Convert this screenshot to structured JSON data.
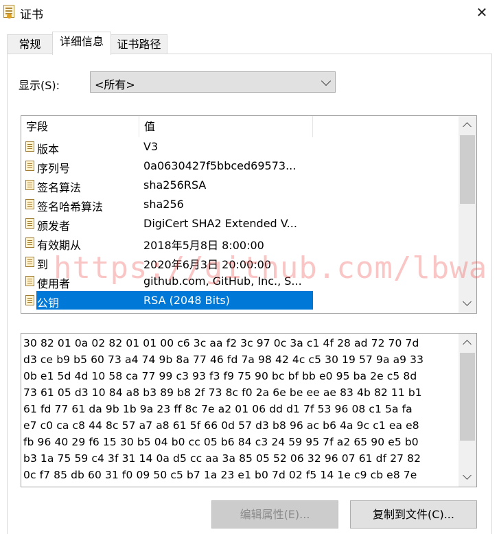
{
  "window": {
    "title": "证书",
    "close_glyph": "✕"
  },
  "tabs": [
    {
      "label": "常规",
      "active": false
    },
    {
      "label": "详细信息",
      "active": true
    },
    {
      "label": "证书路径",
      "active": false
    }
  ],
  "show": {
    "label": "显示(S):",
    "selected": "<所有>"
  },
  "fields_table": {
    "columns": [
      "字段",
      "值"
    ],
    "rows": [
      {
        "name": "版本",
        "value": "V3"
      },
      {
        "name": "序列号",
        "value": "0a0630427f5bbced69573..."
      },
      {
        "name": "签名算法",
        "value": "sha256RSA"
      },
      {
        "name": "签名哈希算法",
        "value": "sha256"
      },
      {
        "name": "颁发者",
        "value": "DigiCert SHA2 Extended V..."
      },
      {
        "name": "有效期从",
        "value": "2018年5月8日 8:00:00"
      },
      {
        "name": "到",
        "value": "2020年6月3日 20:00:00"
      },
      {
        "name": "使用者",
        "value": "github.com, GitHub, Inc., S..."
      },
      {
        "name": "公钥",
        "value": "RSA (2048 Bits)"
      }
    ],
    "selected_index": 8
  },
  "value_detail": [
    "30 82 01 0a 02 82 01 01 00 c6 3c aa f2 3c 97 0c 3a c1 4f 28 ad 72 70 7d",
    "d3 ce b9 b5 60 73 a4 74 9b 8a 77 46 fd 7a 98 42 4c c5 30 19 57 9a a9 33",
    "0b e1 5d 4d 10 58 ca 77 99 c3 93 f3 f9 75 90 bc bf bb e0 95 ba 2e c5 8d",
    "73 61 05 d3 10 84 a8 b3 89 b8 2f 73 8c f0 2a 6e be ee ae 83 4b 82 11 b1",
    "61 fd 77 61 da 9b 1b 9a 23 ff 8c 7e a2 01 06 dd d1 7f 53 96 08 c1 5a fa",
    "e7 c0 ca c8 44 8c 57 a7 a8 61 5f 66 0d 57 d3 b8 96 ac b6 4a 9c c1 ea e8",
    "fb 96 40 29 f6 15 30 b5 04 b0 cc 05 b6 84 c3 24 59 95 7f a2 65 90 e5 b0",
    "b3 1a 75 59 c4 3f 31 14 0a d5 cc aa 3a 85 05 52 06 32 96 07 61 df 27 82",
    "0c f7 85 db 60 31 f0 09 50 c5 b7 1a 23 e1 b0 7d 02 f5 14 1e c9 cb e8 7e"
  ],
  "buttons": {
    "edit_properties": "编辑属性(E)...",
    "copy_to_file": "复制到文件(C)..."
  },
  "watermark": "https://github.com/lbwa",
  "colors": {
    "selection": "#0078d7",
    "watermark": "#f05050"
  }
}
